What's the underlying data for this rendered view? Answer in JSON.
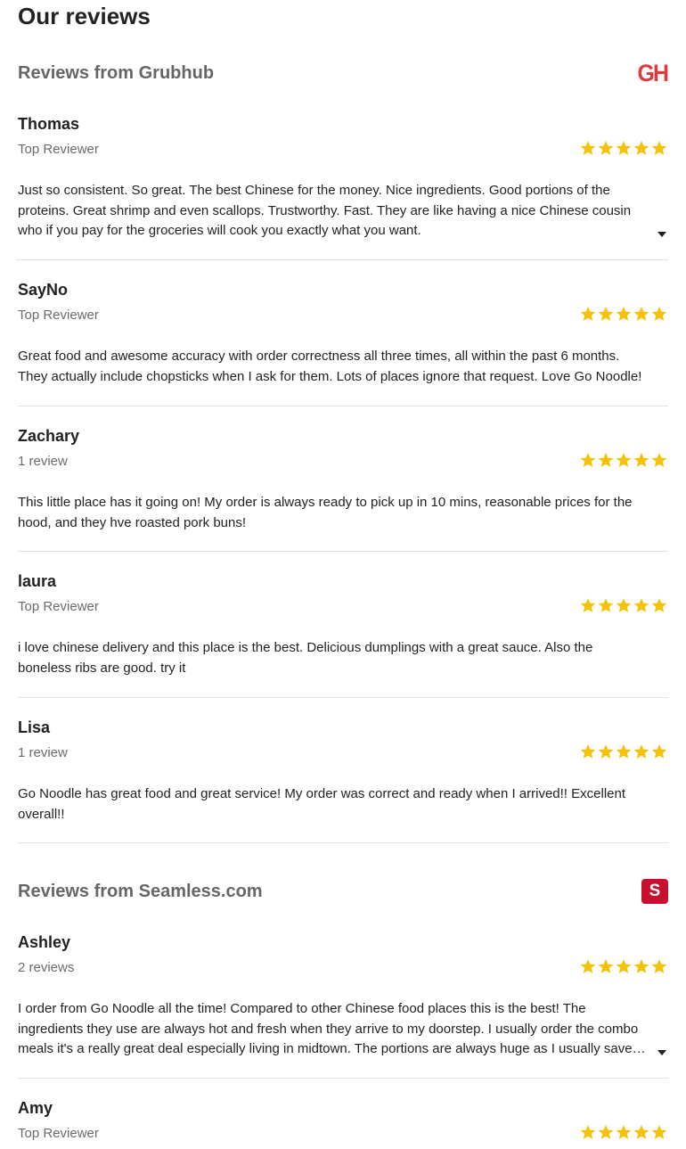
{
  "page": {
    "title": "Our reviews"
  },
  "colors": {
    "star": "#f5c20a",
    "grubhub_red": "#e03a3e",
    "seamless_red": "#c8102e"
  },
  "sections": [
    {
      "title": "Reviews from Grubhub",
      "logo_text": "GH",
      "reviews": [
        {
          "name": "Thomas",
          "meta": "Top Reviewer",
          "rating": 5,
          "text": "Just so consistent. So great. The best Chinese for the money. Nice ingredients. Good portions of the proteins. Great shrimp and even scallops. Trustworthy. Fast. They are like having a nice Chinese cousin who if you pay for the groceries will cook you exactly what you want."
        },
        {
          "name": "SayNo",
          "meta": "Top Reviewer",
          "rating": 5,
          "text": "Great food and awesome accuracy with order correctness all three times, all within the past 6 months. They actually include chopsticks when I ask for them. Lots of places ignore that request. Love Go Noodle!"
        },
        {
          "name": "Zachary",
          "meta": "1 review",
          "rating": 5,
          "text": "This little place has it going on! My order is always ready to pick up in 10 mins, reasonable prices for the hood, and they hve roasted pork buns!"
        },
        {
          "name": "laura",
          "meta": "Top Reviewer",
          "rating": 5,
          "text": "i love chinese delivery and this place is the best. Delicious dumplings with a great sauce. Also the boneless ribs are good. try it"
        },
        {
          "name": "Lisa",
          "meta": "1 review",
          "rating": 5,
          "text": "Go Noodle has great food and great service! My order was correct and ready when I arrived!! Excellent overall!!"
        }
      ]
    },
    {
      "title": "Reviews from Seamless.com",
      "logo_text": "S",
      "reviews": [
        {
          "name": "Ashley",
          "meta": "2 reviews",
          "rating": 5,
          "text": "I order from Go Noodle all the time! Compared to other Chinese food places this is the best! The ingredients they use are always hot and fresh when they arrive to my doorstep. I usually order the combo meals it's a really great deal especially living in midtown. The portions are always huge as I usually save some for later."
        },
        {
          "name": "Amy",
          "meta": "Top Reviewer",
          "rating": 5,
          "text": ""
        }
      ]
    }
  ]
}
